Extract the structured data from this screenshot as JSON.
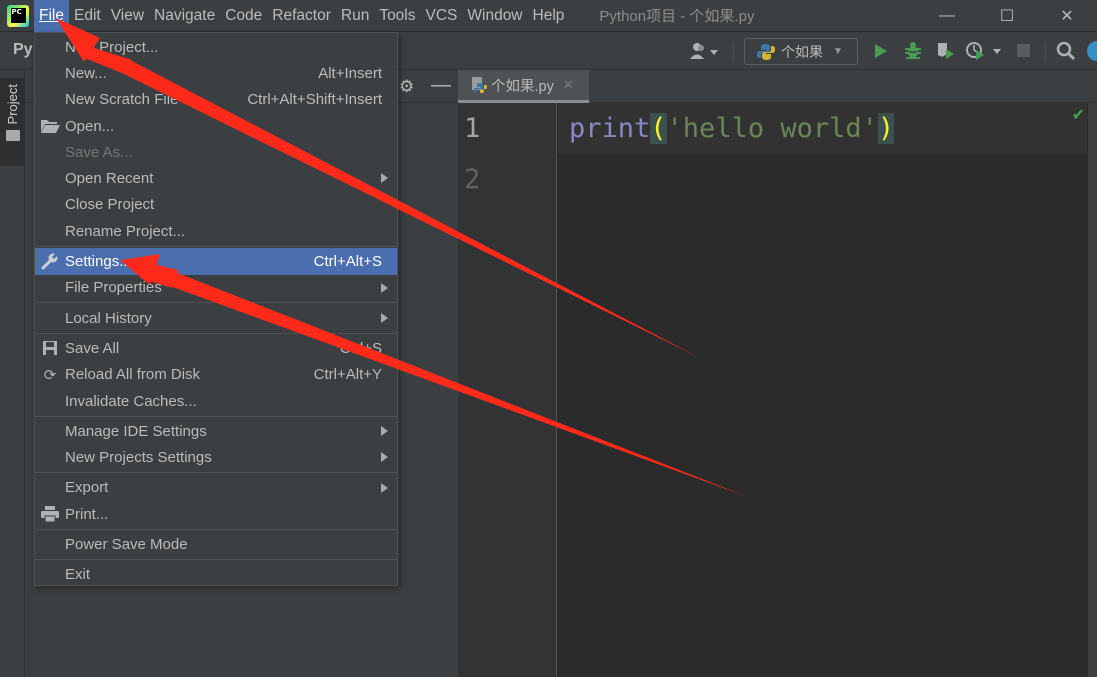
{
  "app": {
    "logo_text": "PC",
    "window_title": "Python项目 - 个如果.py"
  },
  "menubar": {
    "items": [
      {
        "label": "File",
        "mnemonic_index": 0,
        "active": true
      },
      {
        "label": "Edit",
        "mnemonic_index": 0
      },
      {
        "label": "View",
        "mnemonic_index": 0
      },
      {
        "label": "Navigate",
        "mnemonic_index": 0
      },
      {
        "label": "Code",
        "mnemonic_index": 0
      },
      {
        "label": "Refactor",
        "mnemonic_index": 0
      },
      {
        "label": "Run",
        "mnemonic_index": 1
      },
      {
        "label": "Tools",
        "mnemonic_index": 0
      },
      {
        "label": "VCS",
        "mnemonic_index": 2
      },
      {
        "label": "Window",
        "mnemonic_index": 0
      },
      {
        "label": "Help",
        "mnemonic_index": 0
      }
    ]
  },
  "window_controls": {
    "minimize": "—",
    "maximize": "☐",
    "close": "✕"
  },
  "toolbar": {
    "breadcrumb_project": "Py",
    "run_config": "个如果",
    "icons": [
      "user-icon",
      "python-icon",
      "run-icon",
      "debug-icon",
      "coverage-icon",
      "profile-icon",
      "stop-icon",
      "search-icon",
      "update-icon"
    ]
  },
  "tool_window": {
    "project_label": "Project"
  },
  "editor": {
    "tab_label": "个如果.py",
    "lines": [
      {
        "number": "1",
        "tokens": [
          {
            "type": "builtin",
            "text": "print"
          },
          {
            "type": "paren",
            "text": "("
          },
          {
            "type": "string",
            "text": "'hello world'"
          },
          {
            "type": "paren",
            "text": ")"
          }
        ]
      },
      {
        "number": "2",
        "tokens": []
      }
    ],
    "inspection_status": "✔"
  },
  "file_menu": {
    "items": [
      {
        "label": "New Project...",
        "shortcut": "",
        "icon": "",
        "submenu": false
      },
      {
        "label": "New...",
        "shortcut": "Alt+Insert",
        "icon": "",
        "submenu": false
      },
      {
        "label": "New Scratch File",
        "shortcut": "Ctrl+Alt+Shift+Insert",
        "icon": "",
        "submenu": false
      },
      {
        "label": "Open...",
        "shortcut": "",
        "icon": "folder-open-icon",
        "submenu": false
      },
      {
        "label": "Save As...",
        "shortcut": "",
        "icon": "",
        "submenu": false,
        "disabled": true
      },
      {
        "label": "Open Recent",
        "shortcut": "",
        "icon": "",
        "submenu": true
      },
      {
        "label": "Close Project",
        "shortcut": "",
        "icon": "",
        "submenu": false
      },
      {
        "label": "Rename Project...",
        "shortcut": "",
        "icon": "",
        "submenu": false
      },
      {
        "label": "Settings...",
        "shortcut": "Ctrl+Alt+S",
        "icon": "wrench-icon",
        "submenu": false,
        "selected": true
      },
      {
        "label": "File Properties",
        "shortcut": "",
        "icon": "",
        "submenu": true
      },
      {
        "label": "Local History",
        "shortcut": "",
        "icon": "",
        "submenu": true
      },
      {
        "label": "Save All",
        "shortcut": "Ctrl+S",
        "icon": "save-icon",
        "submenu": false
      },
      {
        "label": "Reload All from Disk",
        "shortcut": "Ctrl+Alt+Y",
        "icon": "reload-icon",
        "submenu": false
      },
      {
        "label": "Invalidate Caches...",
        "shortcut": "",
        "icon": "",
        "submenu": false
      },
      {
        "label": "Manage IDE Settings",
        "shortcut": "",
        "icon": "",
        "submenu": true
      },
      {
        "label": "New Projects Settings",
        "shortcut": "",
        "icon": "",
        "submenu": true
      },
      {
        "label": "Export",
        "shortcut": "",
        "icon": "",
        "submenu": true
      },
      {
        "label": "Print...",
        "shortcut": "",
        "icon": "printer-icon",
        "submenu": false
      },
      {
        "label": "Power Save Mode",
        "shortcut": "",
        "icon": "",
        "submenu": false
      },
      {
        "label": "Exit",
        "shortcut": "",
        "icon": "",
        "submenu": false
      }
    ]
  },
  "colors": {
    "accent_selection": "#4b6eaf",
    "annotation_arrow": "#ff2a1a",
    "builtin": "#8888c6",
    "string": "#6a8759",
    "paren_match": "#ffef28",
    "run_green": "#499c54"
  }
}
